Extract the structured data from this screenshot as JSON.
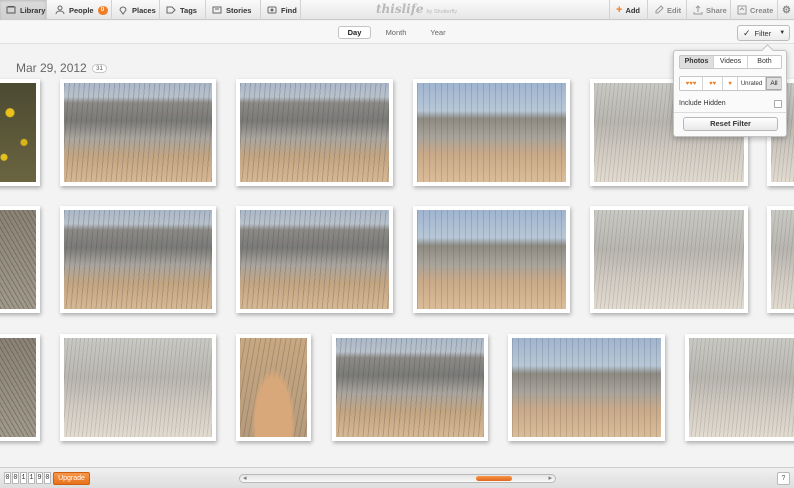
{
  "topbar": {
    "nav": [
      {
        "label": "Library",
        "icon": "library-icon"
      },
      {
        "label": "People",
        "icon": "people-icon",
        "badge": "0"
      },
      {
        "label": "Places",
        "icon": "places-icon"
      },
      {
        "label": "Tags",
        "icon": "tags-icon"
      },
      {
        "label": "Stories",
        "icon": "stories-icon"
      },
      {
        "label": "Find",
        "icon": "find-icon"
      }
    ],
    "logo_main": "thislife",
    "logo_sub": "by Shutterfly",
    "actions": [
      {
        "label": "Add",
        "icon": "add-icon"
      },
      {
        "label": "Edit",
        "icon": "edit-icon"
      },
      {
        "label": "Share",
        "icon": "share-icon"
      },
      {
        "label": "Create",
        "icon": "create-icon"
      }
    ],
    "settings_icon": "gear-icon"
  },
  "view_tabs": {
    "items": [
      "Day",
      "Month",
      "Year"
    ],
    "active": "Day"
  },
  "filter_button": {
    "label": "Filter",
    "icon": "checkmark-icon"
  },
  "date_group": {
    "title": "Mar 29, 2012",
    "count": "31"
  },
  "photos": [
    {
      "style": "flowers"
    },
    {
      "style": "badlands"
    },
    {
      "style": "badlands"
    },
    {
      "style": "flat"
    },
    {
      "style": "pale"
    },
    {
      "style": "pale"
    },
    {
      "style": "brush"
    },
    {
      "style": "badlands"
    },
    {
      "style": "badlands"
    },
    {
      "style": "flat"
    },
    {
      "style": "pale"
    },
    {
      "style": "pale"
    },
    {
      "style": "brush"
    },
    {
      "style": "pale"
    },
    {
      "style": "canyon"
    },
    {
      "style": "badlands"
    },
    {
      "style": "flat"
    },
    {
      "style": "pale"
    }
  ],
  "filter_popover": {
    "media_types": [
      "Photos",
      "Videos",
      "Both"
    ],
    "active_media": "Photos",
    "ratings": [
      "♥♥♥",
      "♥♥",
      "♥"
    ],
    "unrated_label": "Unrated",
    "all_label": "All",
    "include_hidden_label": "Include Hidden",
    "include_hidden_checked": false,
    "reset_label": "Reset Filter"
  },
  "bottombar": {
    "counter_digits": [
      "0",
      "0",
      "1",
      "1",
      "9",
      "0"
    ],
    "upgrade_label": "Upgrade",
    "help_label": "?"
  },
  "colors": {
    "accent": "#ef7d22",
    "badge": "#f07e26"
  }
}
